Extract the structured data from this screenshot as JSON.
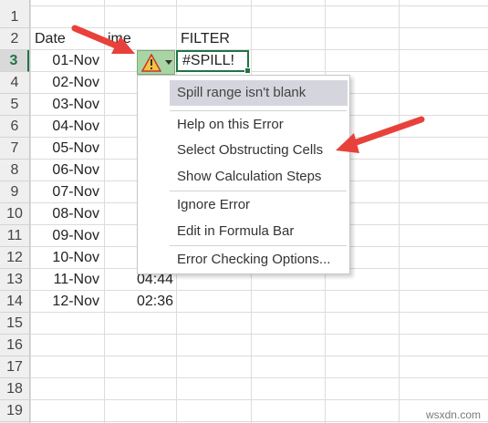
{
  "rows": [
    "1",
    "2",
    "3",
    "4",
    "5",
    "6",
    "7",
    "8",
    "9",
    "10",
    "11",
    "12",
    "13",
    "14",
    "15",
    "16",
    "17",
    "18",
    "19"
  ],
  "active_row": "3",
  "headers": {
    "date": "Date",
    "time": "ime",
    "filter": "FILTER"
  },
  "dates": [
    "01-Nov",
    "02-Nov",
    "03-Nov",
    "04-Nov",
    "05-Nov",
    "06-Nov",
    "07-Nov",
    "08-Nov",
    "09-Nov",
    "10-Nov",
    "11-Nov",
    "12-Nov"
  ],
  "visible_times": {
    "row13": "04:44",
    "row14": "02:36"
  },
  "spill_cell": "#SPILL!",
  "error_button": {
    "icon": "warning-triangle-icon",
    "dropdown_icon": "caret-down-icon"
  },
  "error_menu": {
    "header": "Spill range isn't blank",
    "items": [
      "Help on this Error",
      "Select Obstructing Cells",
      "Show Calculation Steps",
      "Ignore Error",
      "Edit in Formula Bar",
      "Error Checking Options..."
    ]
  },
  "colors": {
    "excel_green": "#217346",
    "arrow_red": "#e8413b",
    "error_button_bg": "#a9d5a4"
  },
  "watermark": "wsxdn.com"
}
